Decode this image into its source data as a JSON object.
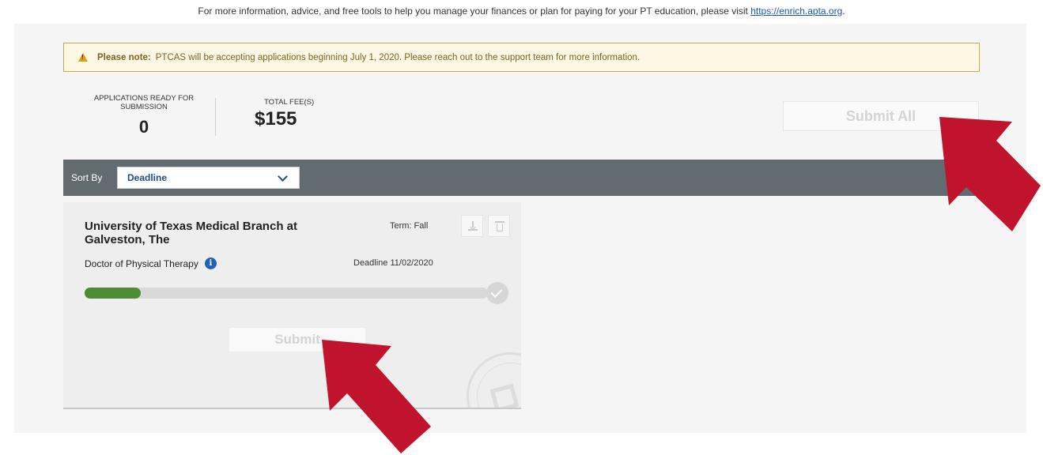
{
  "header": {
    "info_text": "For more information, advice, and free tools to help you manage your finances or plan for paying for your PT education, please visit ",
    "info_link": "https://enrich.apta.org",
    "info_suffix": "."
  },
  "note": {
    "label": "Please note:",
    "text": "PTCAS will be accepting applications beginning July 1, 2020. Please reach out to the support team for more information.",
    "icon": "warning-icon"
  },
  "summary": {
    "ready_label": "APPLICATIONS READY FOR SUBMISSION",
    "ready_value": "0",
    "fee_label": "TOTAL FEE(S)",
    "fee_value": "$155",
    "submit_all_label": "Submit All"
  },
  "sort": {
    "label": "Sort By",
    "selected": "Deadline"
  },
  "applications": [
    {
      "school": "University of Texas Medical Branch at Galveston, The",
      "term": "Term: Fall",
      "program": "Doctor of Physical Therapy",
      "deadline": "Deadline 11/02/2020",
      "progress_fraction": 0.14,
      "submit_label": "Submit"
    }
  ],
  "colors": {
    "annotation_arrow": "#c0142e",
    "progress": "#4f8a34",
    "sortbar": "#626b6f",
    "link": "#1a56b8"
  }
}
